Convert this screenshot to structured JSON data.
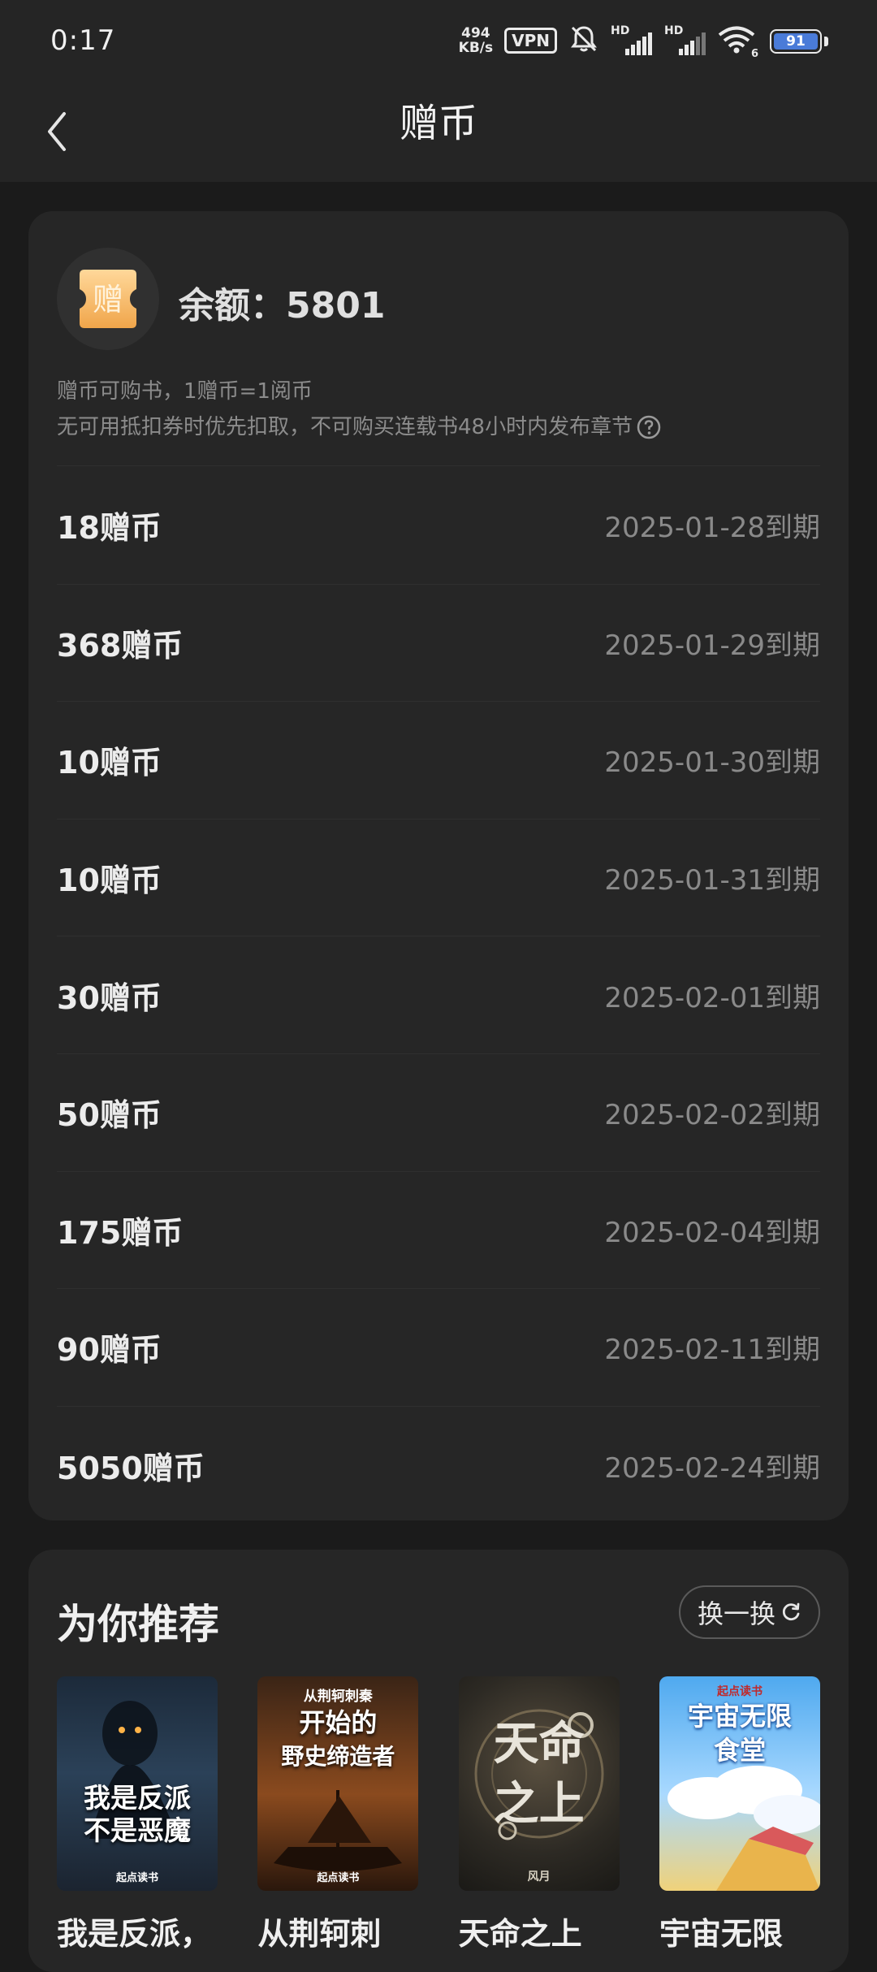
{
  "status_bar": {
    "time": "0:17",
    "net_speed_value": "494",
    "net_speed_unit": "KB/s",
    "vpn": "VPN",
    "hd1": "HD",
    "hd2": "HD",
    "wifi_sub": "6",
    "battery": "91"
  },
  "nav": {
    "title": "赠币"
  },
  "balance": {
    "icon_char": "赠",
    "text": "余额：5801",
    "note_line1": "赠币可购书，1赠币=1阅币",
    "note_line2": "无可用抵扣券时优先扣取，不可购买连载书48小时内发布章节"
  },
  "coins": [
    {
      "amount": "18赠币",
      "expiry": "2025-01-28到期"
    },
    {
      "amount": "368赠币",
      "expiry": "2025-01-29到期"
    },
    {
      "amount": "10赠币",
      "expiry": "2025-01-30到期"
    },
    {
      "amount": "10赠币",
      "expiry": "2025-01-31到期"
    },
    {
      "amount": "30赠币",
      "expiry": "2025-02-01到期"
    },
    {
      "amount": "50赠币",
      "expiry": "2025-02-02到期"
    },
    {
      "amount": "175赠币",
      "expiry": "2025-02-04到期"
    },
    {
      "amount": "90赠币",
      "expiry": "2025-02-11到期"
    },
    {
      "amount": "5050赠币",
      "expiry": "2025-02-24到期"
    }
  ],
  "recommend": {
    "title": "为你推荐",
    "refresh_label": "换一换",
    "books": [
      {
        "title": "我是反派，",
        "cover_line1": "我是反派",
        "cover_line2": "不是恶魔",
        "cover_brand": "起点读书"
      },
      {
        "title": "从荆轲刺",
        "cover_top": "从荆轲刺秦",
        "cover_line1": "开始的",
        "cover_line2": "野史缔造者",
        "cover_brand": "起点读书"
      },
      {
        "title": "天命之上",
        "cover_line1": "天命",
        "cover_line2": "之上",
        "cover_author": "风月"
      },
      {
        "title": "宇宙无限",
        "cover_brand": "起点读书",
        "cover_line1": "宇宙无限",
        "cover_line2": "食堂"
      }
    ]
  }
}
